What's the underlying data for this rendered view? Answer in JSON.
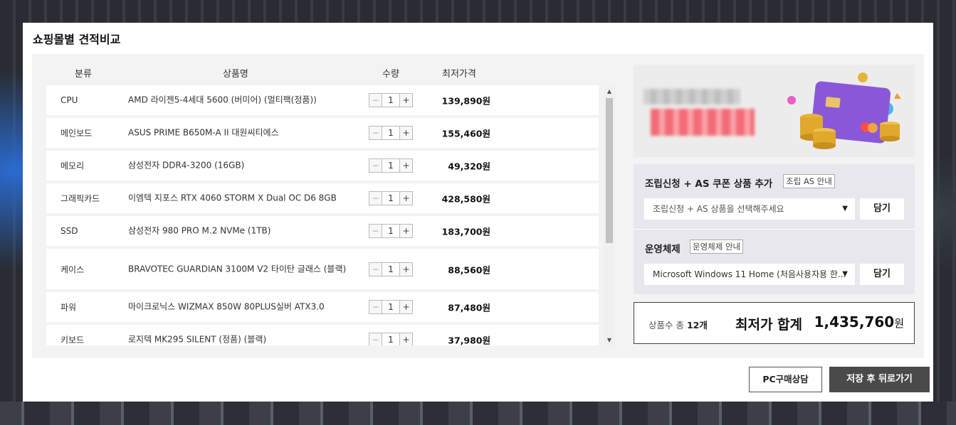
{
  "modal": {
    "title": "쇼핑몰별 견적비교"
  },
  "columns": {
    "category": "분류",
    "product": "상품명",
    "quantity": "수량",
    "price": "최저가격"
  },
  "stepper": {
    "minus": "−",
    "plus": "+"
  },
  "rows": [
    {
      "category": "CPU",
      "name": "AMD 라이젠5-4세대 5600 (버미어) (멀티팩(정품))",
      "qty": "1",
      "price": "139,890원"
    },
    {
      "category": "메인보드",
      "name": "ASUS PRIME B650M-A II 대원씨티에스",
      "qty": "1",
      "price": "155,460원"
    },
    {
      "category": "메모리",
      "name": "삼성전자 DDR4-3200 (16GB)",
      "qty": "1",
      "price": "49,320원"
    },
    {
      "category": "그래픽카드",
      "name": "이엠텍 지포스 RTX 4060 STORM X Dual OC D6 8GB",
      "qty": "1",
      "price": "428,580원"
    },
    {
      "category": "SSD",
      "name": "삼성전자 980 PRO M.2 NVMe (1TB)",
      "qty": "1",
      "price": "183,700원"
    },
    {
      "category": "케이스",
      "name": "BRAVOTEC GUARDIAN 3100M V2 타이탄 글래스 (블랙)",
      "qty": "1",
      "price": "88,560원"
    },
    {
      "category": "파워",
      "name": "마이크로닉스 WIZMAX 850W 80PLUS실버 ATX3.0",
      "qty": "1",
      "price": "87,480원"
    },
    {
      "category": "키보드",
      "name": "로지텍 MK295 SILENT (정품) (블랙)",
      "qty": "1",
      "price": "37,980원"
    }
  ],
  "assembly": {
    "title": "조립신청 + AS 쿠폰 상품 추가",
    "badge": "조립 AS 안내",
    "placeholder": "조립신청 + AS 상품을 선택해주세요",
    "button": "담기"
  },
  "os": {
    "title": "운영체제",
    "badge": "운영체제 안내",
    "selected": "Microsoft Windows 11 Home (처음사용자용 한...",
    "button": "담기"
  },
  "total": {
    "count_prefix": "상품수 총",
    "count": "12개",
    "label": "최저가 합계",
    "sum": "1,435,760",
    "unit": "원"
  },
  "buttons": {
    "consult": "PC구매상담",
    "save": "저장 후 뒤로가기"
  },
  "colors": {
    "accent_dark": "#4a4a4a",
    "panel_bg": "#f3f3f3",
    "option_bg": "#e9e7ee"
  }
}
